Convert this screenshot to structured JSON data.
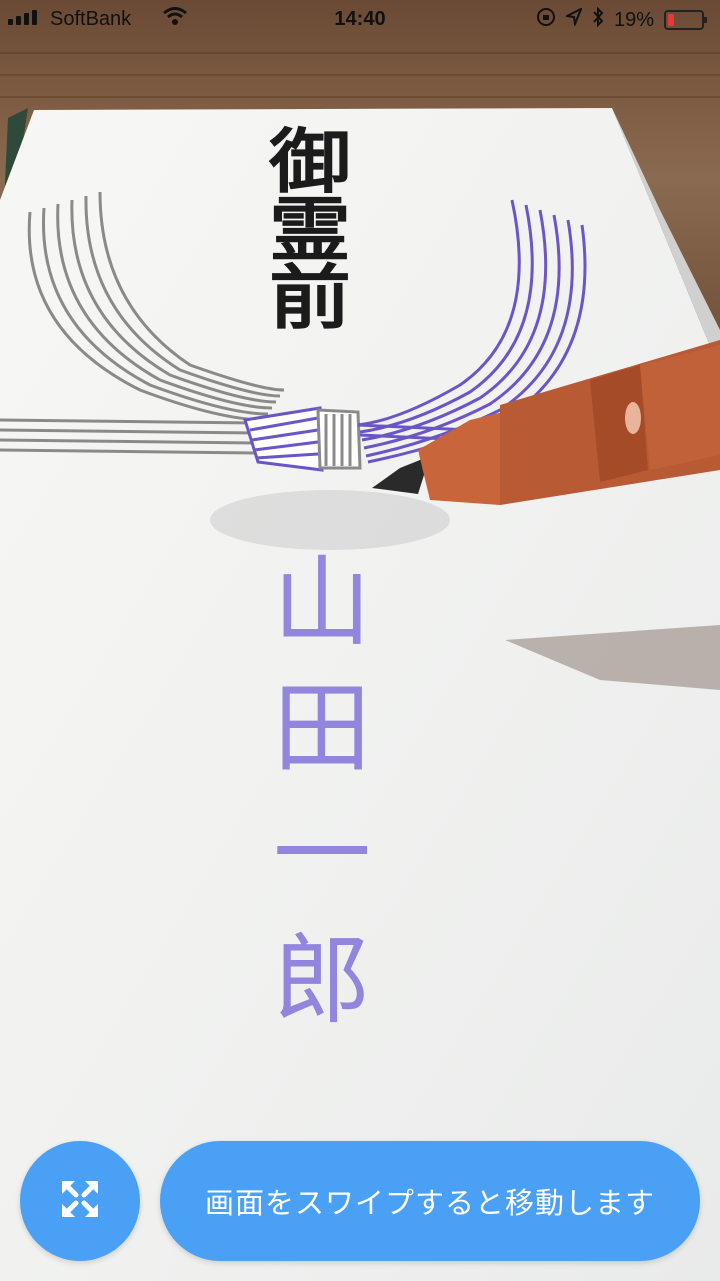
{
  "status_bar": {
    "carrier": "SoftBank",
    "time": "14:40",
    "battery_percent": "19%",
    "battery_level": 0.19,
    "battery_color": "#e53935",
    "icons": [
      "signal-bars-icon",
      "wifi-icon",
      "orientation-lock-icon",
      "location-icon",
      "bluetooth-icon",
      "battery-icon"
    ]
  },
  "envelope": {
    "printed_title": [
      "御",
      "霊",
      "前"
    ],
    "overlay_name": [
      "山",
      "田",
      "一",
      "郎"
    ],
    "overlay_color": "#8273dc",
    "cord_colors": {
      "left": "#8a8a8a",
      "right": "#6b55c8"
    }
  },
  "controls": {
    "expand_icon": "expand-arrows-icon",
    "hint_text": "画面をスワイプすると移動します",
    "accent": "#4aa0f5"
  }
}
